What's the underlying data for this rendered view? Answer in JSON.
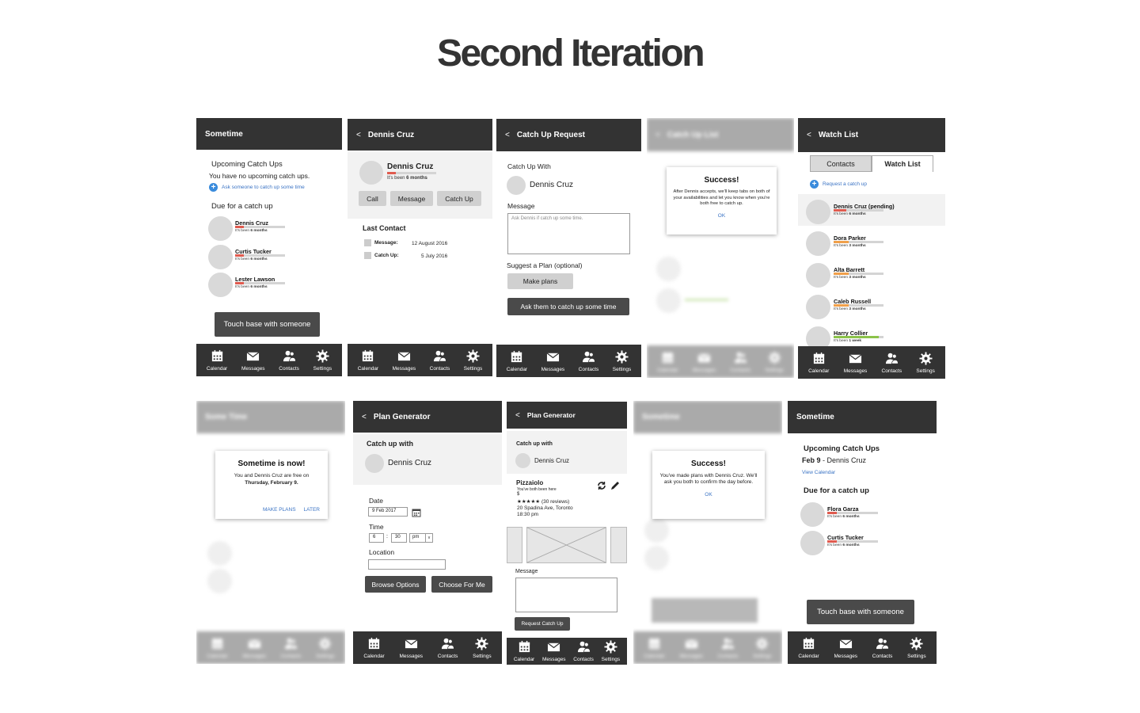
{
  "page": {
    "title": "Second Iteration"
  },
  "nav": {
    "calendar": "Calendar",
    "messages": "Messages",
    "contacts": "Contacts",
    "settings": "Settings"
  },
  "common": {
    "its_been": "It's been"
  },
  "s1": {
    "header": "Sometime",
    "upcoming_title": "Upcoming Catch Ups",
    "no_upcoming": "You have no upcoming catch ups.",
    "ask_link": "Ask someone to catch up some time",
    "due_title": "Due for a catch up",
    "contacts": [
      {
        "name": "Dennis Cruz",
        "duration": "6 months"
      },
      {
        "name": "Curtis Tucker",
        "duration": "6 months"
      },
      {
        "name": "Lester Lawson",
        "duration": "6 months"
      }
    ],
    "cta": "Touch base with someone"
  },
  "s2": {
    "header": "Dennis Cruz",
    "name": "Dennis Cruz",
    "duration": "6 months",
    "btn_call": "Call",
    "btn_message": "Message",
    "btn_catchup": "Catch Up",
    "last_contact": "Last Contact",
    "message_label": "Message:",
    "message_date": "12 August 2016",
    "catchup_label": "Catch Up:",
    "catchup_date": "5 July 2016"
  },
  "s3": {
    "header": "Catch Up Request",
    "catch_up_with": "Catch Up With",
    "name": "Dennis Cruz",
    "message_label": "Message",
    "message_placeholder": "Ask Dennis if catch up some time.",
    "suggest_label": "Suggest a Plan (optional)",
    "make_plans": "Make plans",
    "cta": "Ask them to catch up some time"
  },
  "s4": {
    "header": "Catch Up List",
    "dialog_title": "Success!",
    "dialog_body": "After Dennis accepts, we'll keep tabs on both of your availabilities and let you know when you're both free to catch up.",
    "dialog_ok": "OK"
  },
  "s5": {
    "header": "Watch List",
    "tab_contacts": "Contacts",
    "tab_watchlist": "Watch List",
    "request_link": "Request a catch up",
    "contacts": [
      {
        "name": "Dennis Cruz (pending)",
        "duration": "6 months",
        "color": "#e05b4f",
        "fill": 0.25
      },
      {
        "name": "Dora Parker",
        "duration": "3 months",
        "color": "#f0a04b",
        "fill": 0.3
      },
      {
        "name": "Alta Barrett",
        "duration": "3 months",
        "color": "#f0a04b",
        "fill": 0.3
      },
      {
        "name": "Caleb Russell",
        "duration": "3 months",
        "color": "#f0a04b",
        "fill": 0.3
      },
      {
        "name": "Harry Collier",
        "duration": "1 week",
        "color": "#8bc34a",
        "fill": 0.9
      }
    ]
  },
  "s6": {
    "header": "Some Time",
    "dialog_title": "Sometime is now!",
    "dialog_body": "You and Dennis Cruz are free on",
    "dialog_date": "Thursday, February 9.",
    "make_plans": "MAKE PLANS",
    "later": "LATER"
  },
  "s7": {
    "header": "Plan Generator",
    "catch_up_with": "Catch up with",
    "name": "Dennis Cruz",
    "date_label": "Date",
    "date_value": "9 Feb 2017",
    "time_label": "Time",
    "hour": "6",
    "minute": "30",
    "ampm": "pm",
    "location_label": "Location",
    "browse": "Browse Options",
    "choose": "Choose For Me"
  },
  "s8": {
    "header": "Plan Generator",
    "catch_up_with": "Catch up with",
    "name": "Dennis Cruz",
    "venue": "Pizzaiolo",
    "been_here": "You've both been here",
    "price": "$",
    "rating": "★★★★★ (30 reviews)",
    "address": "20 Spadina Ave, Toronto",
    "time": "18:30 pm",
    "message_label": "Message",
    "request": "Request Catch Up"
  },
  "s9": {
    "header": "Sometime",
    "dialog_title": "Success!",
    "dialog_body": "You've made plans with Dennis Cruz. We'll ask you both to confirm the day before.",
    "dialog_ok": "OK"
  },
  "s10": {
    "header": "Sometime",
    "upcoming_title": "Upcoming Catch Ups",
    "upcoming_date": "Feb 9",
    "upcoming_name": " - Dennis Cruz",
    "view_calendar": "View Calendar",
    "due_title": "Due for a catch up",
    "contacts": [
      {
        "name": "Flora Garza",
        "duration": "6 months"
      },
      {
        "name": "Curtis Tucker",
        "duration": "6 months"
      }
    ],
    "cta": "Touch base with someone"
  }
}
